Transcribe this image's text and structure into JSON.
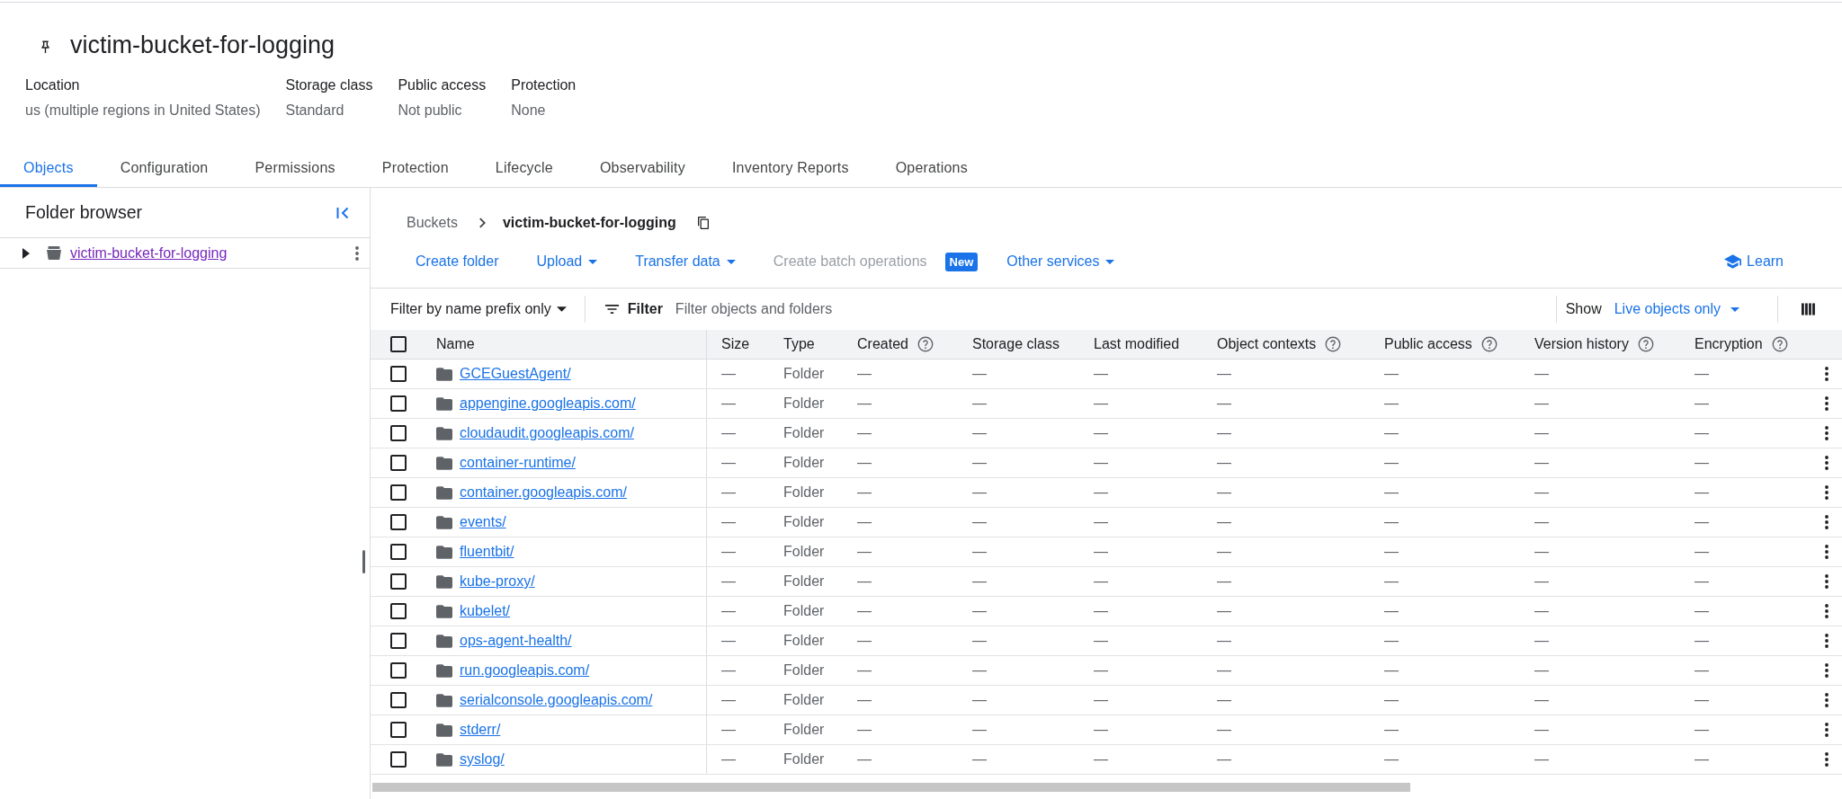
{
  "bucket": {
    "title": "victim-bucket-for-logging"
  },
  "details": [
    {
      "label": "Location",
      "value": "us (multiple regions in United States)"
    },
    {
      "label": "Storage class",
      "value": "Standard"
    },
    {
      "label": "Public access",
      "value": "Not public"
    },
    {
      "label": "Protection",
      "value": "None"
    }
  ],
  "tabs": [
    {
      "label": "Objects",
      "selected": true
    },
    {
      "label": "Configuration",
      "selected": false
    },
    {
      "label": "Permissions",
      "selected": false
    },
    {
      "label": "Protection",
      "selected": false
    },
    {
      "label": "Lifecycle",
      "selected": false
    },
    {
      "label": "Observability",
      "selected": false
    },
    {
      "label": "Inventory Reports",
      "selected": false
    },
    {
      "label": "Operations",
      "selected": false
    }
  ],
  "folder_browser": {
    "title": "Folder browser",
    "items": [
      {
        "label": "victim-bucket-for-logging",
        "expanded": false,
        "visited": true
      }
    ]
  },
  "breadcrumb": [
    {
      "label": "Buckets",
      "current": false
    },
    {
      "label": "victim-bucket-for-logging",
      "current": true
    }
  ],
  "actions": [
    {
      "label": "Create folder",
      "kind": "button",
      "disabled": false
    },
    {
      "label": "Upload",
      "kind": "menu",
      "disabled": false
    },
    {
      "label": "Transfer data",
      "kind": "menu",
      "disabled": false
    },
    {
      "label": "Create batch operations",
      "kind": "button",
      "disabled": true,
      "badge": "New"
    },
    {
      "label": "Other services",
      "kind": "menu",
      "disabled": false
    }
  ],
  "learn": {
    "label": "Learn"
  },
  "filter_bar": {
    "mode": "Filter by name prefix only",
    "filter_label": "Filter",
    "placeholder": "Filter objects and folders",
    "show_label": "Show",
    "show_value": "Live objects only"
  },
  "table": {
    "all_checked": false,
    "columns": [
      {
        "label": "Name",
        "help": false
      },
      {
        "label": "Size",
        "help": false
      },
      {
        "label": "Type",
        "help": false
      },
      {
        "label": "Created",
        "help": true
      },
      {
        "label": "Storage class",
        "help": false
      },
      {
        "label": "Last modified",
        "help": false
      },
      {
        "label": "Object contexts",
        "help": true
      },
      {
        "label": "Public access",
        "help": true
      },
      {
        "label": "Version history",
        "help": true
      },
      {
        "label": "Encryption",
        "help": true
      }
    ],
    "rows": [
      {
        "checked": false,
        "cells": [
          "GCEGuestAgent/",
          "—",
          "Folder",
          "—",
          "—",
          "—",
          "—",
          "—",
          "—",
          "—"
        ]
      },
      {
        "checked": false,
        "cells": [
          "appengine.googleapis.com/",
          "—",
          "Folder",
          "—",
          "—",
          "—",
          "—",
          "—",
          "—",
          "—"
        ]
      },
      {
        "checked": false,
        "cells": [
          "cloudaudit.googleapis.com/",
          "—",
          "Folder",
          "—",
          "—",
          "—",
          "—",
          "—",
          "—",
          "—"
        ]
      },
      {
        "checked": false,
        "cells": [
          "container-runtime/",
          "—",
          "Folder",
          "—",
          "—",
          "—",
          "—",
          "—",
          "—",
          "—"
        ]
      },
      {
        "checked": false,
        "cells": [
          "container.googleapis.com/",
          "—",
          "Folder",
          "—",
          "—",
          "—",
          "—",
          "—",
          "—",
          "—"
        ]
      },
      {
        "checked": false,
        "cells": [
          "events/",
          "—",
          "Folder",
          "—",
          "—",
          "—",
          "—",
          "—",
          "—",
          "—"
        ]
      },
      {
        "checked": false,
        "cells": [
          "fluentbit/",
          "—",
          "Folder",
          "—",
          "—",
          "—",
          "—",
          "—",
          "—",
          "—"
        ]
      },
      {
        "checked": false,
        "cells": [
          "kube-proxy/",
          "—",
          "Folder",
          "—",
          "—",
          "—",
          "—",
          "—",
          "—",
          "—"
        ]
      },
      {
        "checked": false,
        "cells": [
          "kubelet/",
          "—",
          "Folder",
          "—",
          "—",
          "—",
          "—",
          "—",
          "—",
          "—"
        ]
      },
      {
        "checked": false,
        "cells": [
          "ops-agent-health/",
          "—",
          "Folder",
          "—",
          "—",
          "—",
          "—",
          "—",
          "—",
          "—"
        ]
      },
      {
        "checked": false,
        "cells": [
          "run.googleapis.com/",
          "—",
          "Folder",
          "—",
          "—",
          "—",
          "—",
          "—",
          "—",
          "—"
        ]
      },
      {
        "checked": false,
        "cells": [
          "serialconsole.googleapis.com/",
          "—",
          "Folder",
          "—",
          "—",
          "—",
          "—",
          "—",
          "—",
          "—"
        ]
      },
      {
        "checked": false,
        "cells": [
          "stderr/",
          "—",
          "Folder",
          "—",
          "—",
          "—",
          "—",
          "—",
          "—",
          "—"
        ]
      },
      {
        "checked": false,
        "cells": [
          "syslog/",
          "—",
          "Folder",
          "—",
          "—",
          "—",
          "—",
          "—",
          "—",
          "—"
        ]
      }
    ]
  }
}
